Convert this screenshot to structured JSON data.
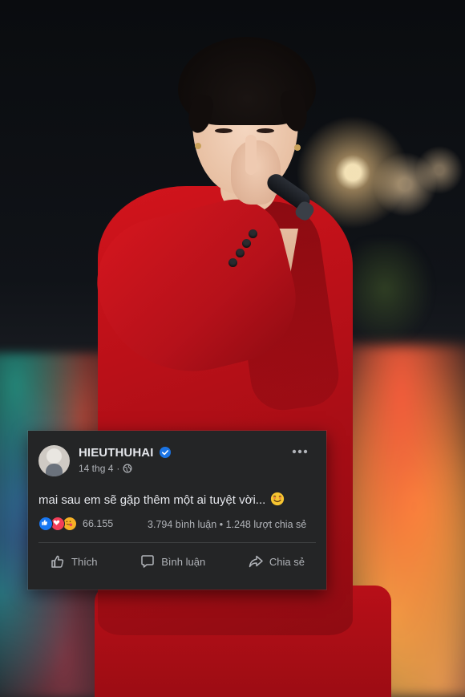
{
  "post": {
    "author": "HIEUTHUHAI",
    "verified": true,
    "date": "14 thg 4",
    "separator": "·",
    "audience_icon": "globe-icon",
    "text": "mai sau em sẽ gặp thêm một ai tuyệt vời...",
    "text_emoji": "smiling-face-icon",
    "reaction_icons": [
      "like-icon",
      "love-icon",
      "care-icon"
    ],
    "reaction_count": "66.155",
    "comments": "3.794 bình luận",
    "shares_separator": "•",
    "shares": "1.248 lượt chia sẻ",
    "actions": {
      "like_label": "Thích",
      "comment_label": "Bình luận",
      "share_label": "Chia sẻ"
    }
  },
  "colors": {
    "card_bg": "#242526",
    "primary_text": "#e4e6eb",
    "secondary_text": "#b0b3b8",
    "verified_blue": "#1b74e4",
    "like_blue": "#1877f2",
    "love_red": "#f33e58",
    "care_yellow": "#f7b125",
    "jacket_red": "#c8121b"
  }
}
